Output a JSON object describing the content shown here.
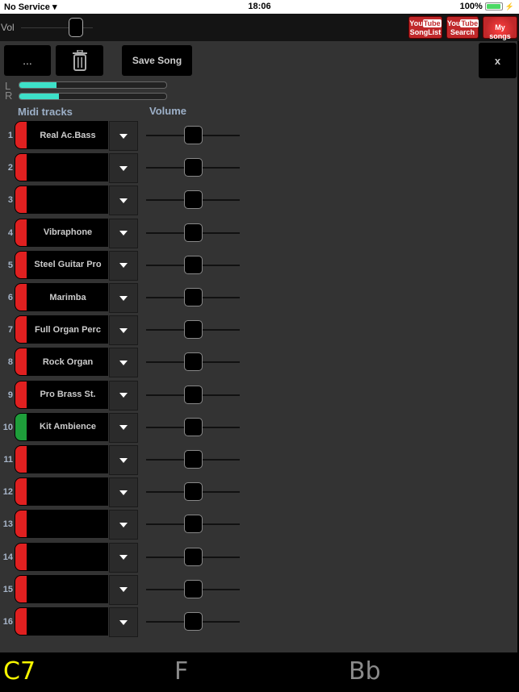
{
  "status_bar": {
    "carrier": "No Service",
    "time": "18:06",
    "battery": "100%",
    "battery_level": 1.0
  },
  "topbar": {
    "vol_label": "Vol",
    "vol_value": 0.75,
    "buttons": [
      {
        "top": "You",
        "tube": "Tube",
        "bottom": "SongList"
      },
      {
        "top": "You",
        "tube": "Tube",
        "bottom": "Search"
      },
      {
        "label": "My songs"
      }
    ]
  },
  "toolbar": {
    "more_label": "...",
    "save_label": "Save Song",
    "close_label": "x"
  },
  "meters": {
    "l_label": "L",
    "r_label": "R",
    "l_level": 0.25,
    "r_level": 0.27
  },
  "headers": {
    "tracks": "Midi tracks",
    "volume": "Volume"
  },
  "colors": {
    "red": "#e02020",
    "green": "#1e9e3a",
    "accent": "#3de0c8",
    "chord_active": "#f5f500",
    "chord_inactive": "#8a8a8a"
  },
  "tracks": [
    {
      "num": "1",
      "name": "Real Ac.Bass",
      "color": "red",
      "volume": 0.5
    },
    {
      "num": "2",
      "name": "",
      "color": "red",
      "volume": 0.5
    },
    {
      "num": "3",
      "name": "",
      "color": "red",
      "volume": 0.5
    },
    {
      "num": "4",
      "name": "Vibraphone",
      "color": "red",
      "volume": 0.5
    },
    {
      "num": "5",
      "name": "Steel Guitar Pro",
      "color": "red",
      "volume": 0.5
    },
    {
      "num": "6",
      "name": "Marimba",
      "color": "red",
      "volume": 0.5
    },
    {
      "num": "7",
      "name": "Full Organ Perc",
      "color": "red",
      "volume": 0.5
    },
    {
      "num": "8",
      "name": "Rock Organ",
      "color": "red",
      "volume": 0.5
    },
    {
      "num": "9",
      "name": "Pro Brass St.",
      "color": "red",
      "volume": 0.5
    },
    {
      "num": "10",
      "name": "Kit Ambience",
      "color": "green",
      "volume": 0.5
    },
    {
      "num": "11",
      "name": "",
      "color": "red",
      "volume": 0.5
    },
    {
      "num": "12",
      "name": "",
      "color": "red",
      "volume": 0.5
    },
    {
      "num": "13",
      "name": "",
      "color": "red",
      "volume": 0.5
    },
    {
      "num": "14",
      "name": "",
      "color": "red",
      "volume": 0.5
    },
    {
      "num": "15",
      "name": "",
      "color": "red",
      "volume": 0.5
    },
    {
      "num": "16",
      "name": "",
      "color": "red",
      "volume": 0.5
    }
  ],
  "chords": [
    {
      "label": "C7",
      "active": true
    },
    {
      "label": "F",
      "active": false
    },
    {
      "label": "Bb",
      "active": false
    }
  ]
}
